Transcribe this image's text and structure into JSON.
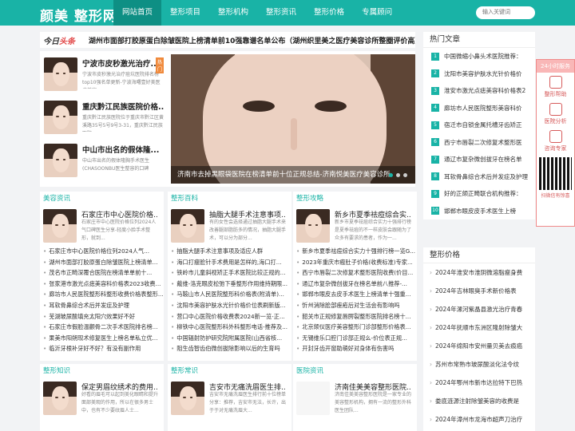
{
  "site": {
    "logo": "颜美 整形网"
  },
  "nav": [
    "网站首页",
    "整形项目",
    "整形机构",
    "整形资讯",
    "整形价格",
    "专属顾问"
  ],
  "search": {
    "placeholder": "输入关键词"
  },
  "headline": {
    "tag_a": "今日",
    "tag_b": "头条",
    "text": "湖州市面部打胶原蛋白除皱医院上榜清单前10强靠谱名单公布（湖州织里美之医疗美容诊所整圈评价高）"
  },
  "featured": [
    {
      "title": "宁波市皮秒激光治疗...",
      "desc": "宁波市皮秒激光治疗痘坑医院排名榜top10强名单更新-宁波海曙壹好美医疗美容",
      "badge": "热门"
    },
    {
      "title": "重庆黔江民族医院价格...",
      "desc": "重庆黔江民族医院位于重庆市黔江区黄溪路35号5号9号3-31，重庆黔江民族医院"
    },
    {
      "title": "中山市出名的假体隆...",
      "desc": "中山市出名的假体隆胸手术医生(CHASOONBU医生整容的口碑"
    }
  ],
  "banner": {
    "caption": "济南市去掉黑眼袋医院在榜清单前十位正规总结-济南悦美医疗美容诊所"
  },
  "hot": {
    "title": "热门文章",
    "items": [
      "中国微缩小鼻头术医院推荐：",
      "沈阳市美容护肤水光针价格价",
      "淮安市激光点痣美容科价格表2",
      "廊坊市人民医院整形美容科价",
      "宿迁市自锁金属托槽牙齿矫正",
      "西宁市唇裂二次修复术整形医",
      "通辽市复杂微创拔牙在榜名单",
      "耳软骨鼻综合术后并发症及护理",
      "好的正颌正畸联合机构推荐：",
      "邯郸市眼皮皮手术医生上榜"
    ]
  },
  "price": {
    "title": "整形价格",
    "items": [
      "2024年淮安市淮阴微溶脂瘦身费",
      "2024年吉林眼臭手术新价格表",
      "2024年漯河紫晶县激光治疗青春",
      "2024年抚顺市东洲区隆射除皱大",
      "2024年绵阳市安州量贝美去痕癌",
      "苏州市常熟市玻尿酸淡化法令纹",
      "2024年鄂州市新市达拉特下巴热",
      "娄底涟源注射除皱美容的收费是",
      "2024年漳州市龙海市超声刀治疗"
    ]
  },
  "sections": [
    {
      "head": "美容资讯",
      "title": "石家庄市中心医院价格...",
      "desc": "石家庄市中心医院价格位列2024人气口碑医生分享-轻度小脸手术整形，就到...",
      "list": [
        "石家庄市中心医院价格位列2024人气...",
        "湖州市面部打胶原蛋白除皱医院上榜清单...",
        "茂名市正畸深覆合医院在榜清单单前十...",
        "张家港市激光点痣美容科价格表2023收费...",
        "廊坊市人民医院整形科整形收费价格表整形...",
        "耳软骨鼻综合术后并发症及护理",
        "芜湖玻尿酸填充太阳穴效果好不好",
        "石家庄市假脸温颧骨二次手术医院排名榜...",
        "果美市阳朔现术修复医生上榜名单私立优...",
        "临沂牙根补牙好不好？有没有副作用"
      ]
    },
    {
      "head": "整形百科",
      "title": "抽脂大腿手术注意事项...",
      "desc": "有的女性会选择通过抽脂大腿手术来改善腿部脂肪多的情况，抽脂大腿手术，可以分为部分...",
      "list": [
        "抽脂大腿手术注意事项及适应人群",
        "海口打瘦脸针手术费用是怎样的,海口打...",
        "铁岭市儿童斜视矫正手术医院比较正规的...",
        "戴维-洛克眼皮松弛下垂整形作用维持期限...",
        "马鞍山市人民医院整形科价格表(附清单)...",
        "沈阳市美容护肤水光针价格价位表刷新版...",
        "营口中心医院价格收费表2024新一览-正...",
        "柳铁中心医院整形科外科整形电话-推荐及...",
        "中国辐射防护研究院附属医院(山西省核...",
        "阻生齿智齿伯微创拔除影响以后的生育吗"
      ]
    },
    {
      "head": "整形攻略",
      "title": "新乡市夏季祛痘综合实...",
      "desc": "新乡市夏季祛痘综合实力十强排行榜是夏季祛痘的不一样皮肤会跟随为了众多有要求的患者，作为一...",
      "list": [
        "新乡市夏季祛痘综合实力十强排行榜一览G...",
        "2023年重庆市瘢肚子价格(收费标准)专家...",
        "西宁市唇裂二次修复术整形医院收费(价目...",
        "通辽市复杂微创拔牙在榜名单前八推荐-...",
        "邯郸市眼皮去皮手术医生上榜清单十强重...",
        "忻州消除脸部痤疮后对生活会有影响吗",
        "韶关市正规修复唇腭裂整形医院排名榜十...",
        "北京颌仪医疗美容整形门诊部整形价格表...",
        "无锡维乐口腔门诊部正规么-价位表正规...",
        "开封牙齿开窗助萌好对身体有伤害吗"
      ]
    },
    {
      "head": "整形知识",
      "title": "保定男眉纹绣术的费用...",
      "desc": "好看的眉毛可以起到美化眼睛和提升面部美观的作用，所以在很多男士中，也有不少要纹眉人士..."
    },
    {
      "head": "整形常识",
      "title": "吉安市无痛洗眉医生排...",
      "desc": "吉安市无痛洗眉医生排行前十位榜单分享：推荐，吉安市无法，长许，出于于对无痛洗眉大..."
    },
    {
      "head": "医院资讯",
      "title": "济南佳美美容整形医院...",
      "desc": "济南佳美美容整形医院是一家专业的美容整形机构，拥有一流的整形外科医生团队..."
    }
  ],
  "float": {
    "top": "24小时服务",
    "items": [
      "整形帮助",
      "医院分析",
      "咨询专家"
    ],
    "qr": "扫微信有惊喜"
  }
}
